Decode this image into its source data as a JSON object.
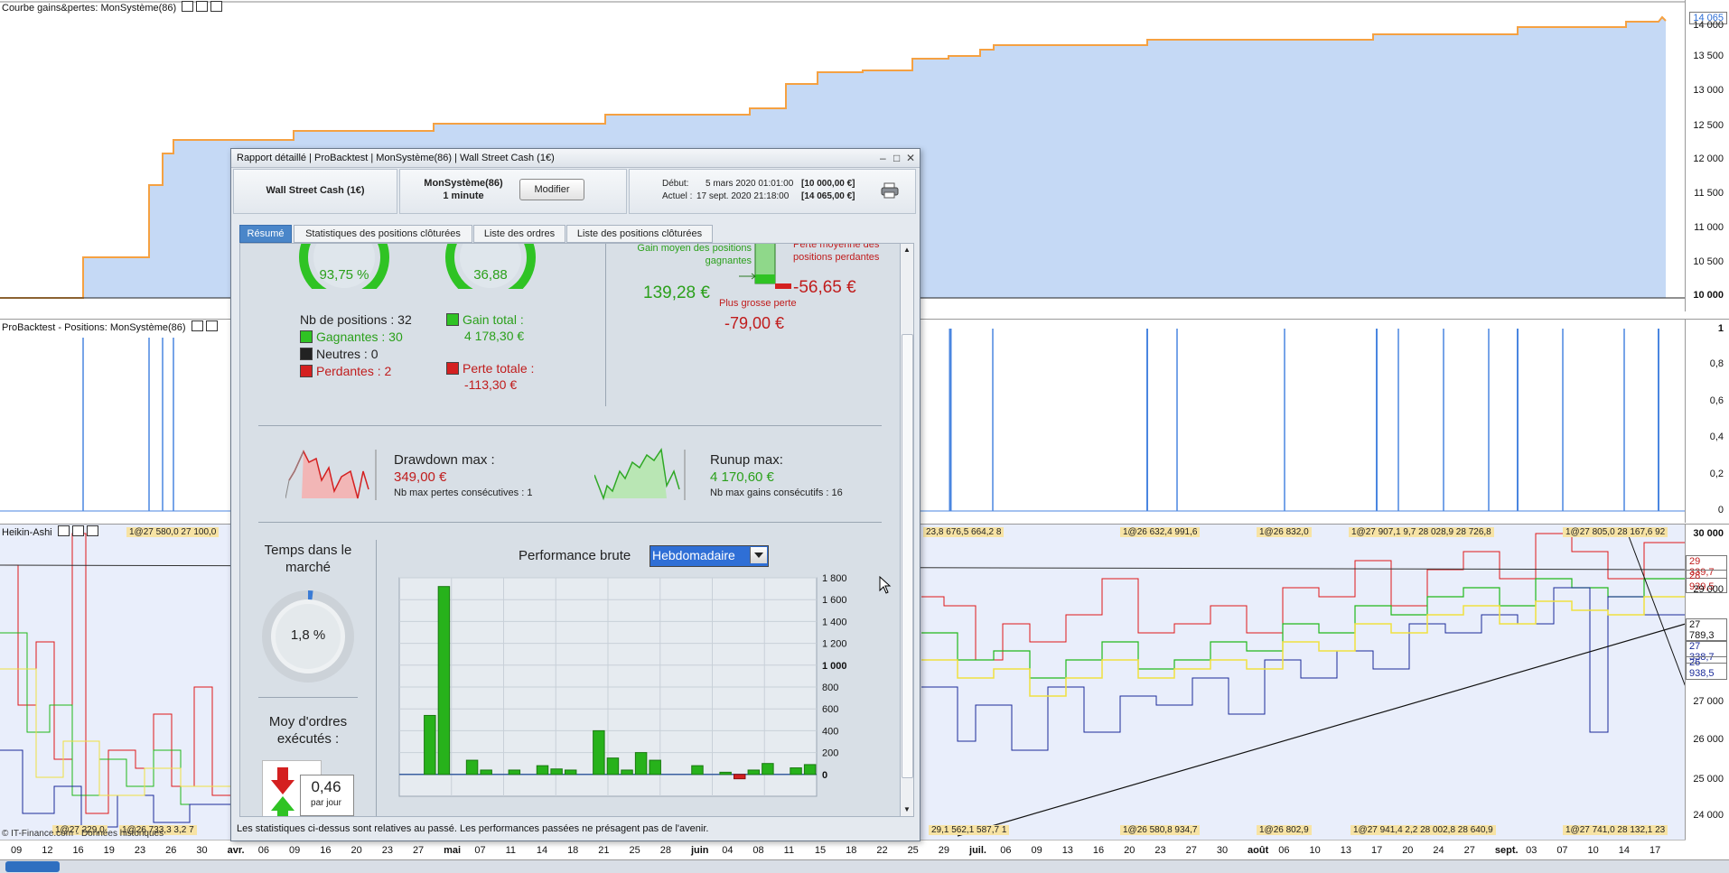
{
  "panels": {
    "equity": {
      "title": "Courbe gains&pertes: MonSystème(86)",
      "ticks": [
        "14 000",
        "13 500",
        "13 000",
        "12 500",
        "12 000",
        "11 500",
        "11 000",
        "10 500",
        "10 000"
      ],
      "last_value": "14 065"
    },
    "positions": {
      "title": "ProBacktest - Positions: MonSystème(86)",
      "ticks": [
        "1",
        "0,8",
        "0,6",
        "0,4",
        "0,2",
        "0"
      ]
    },
    "price": {
      "title": "Heikin-Ashi",
      "ticks": [
        "30 000",
        "29 000",
        "28 000",
        "27 000",
        "26 000",
        "25 000",
        "24 000"
      ],
      "levels": [
        "29 339,7",
        "28 939,5",
        "27 789,3",
        "27 338,7",
        "26 938,5"
      ],
      "tags_top": [
        "1@27 580,0 27 100,0",
        "23,8 676,5 664,2 8",
        "1@26 632,4 991,6",
        "1@26 832,0",
        "1@27 907,1 9,7 28 028,9 28 726,8",
        "1@27 805,0 28 167,6 92"
      ],
      "tags_bottom": [
        "1@27 229,0",
        "1@26 733,3 3,2 7",
        "29,1 562,1 587,7 1",
        "1@26 580,8 934,7",
        "1@26 802,9",
        "1@27 941,4 2,2 28 002,8 28 640,9",
        "1@27 741,0 28 132,1 23"
      ],
      "copyright": "© IT-Finance.com - Données historiques"
    }
  },
  "time_axis": [
    {
      "t": "09"
    },
    {
      "t": "12"
    },
    {
      "t": "16"
    },
    {
      "t": "19"
    },
    {
      "t": "23"
    },
    {
      "t": "26"
    },
    {
      "t": "30"
    },
    {
      "t": "avr.",
      "m": true
    },
    {
      "t": "06"
    },
    {
      "t": "09"
    },
    {
      "t": "16"
    },
    {
      "t": "20"
    },
    {
      "t": "23"
    },
    {
      "t": "27"
    },
    {
      "t": "mai",
      "m": true
    },
    {
      "t": "07"
    },
    {
      "t": "11"
    },
    {
      "t": "14"
    },
    {
      "t": "18"
    },
    {
      "t": "21"
    },
    {
      "t": "25"
    },
    {
      "t": "28"
    },
    {
      "t": "juin",
      "m": true
    },
    {
      "t": "04"
    },
    {
      "t": "08"
    },
    {
      "t": "11"
    },
    {
      "t": "15"
    },
    {
      "t": "18"
    },
    {
      "t": "22"
    },
    {
      "t": "25"
    },
    {
      "t": "29"
    },
    {
      "t": "juil.",
      "m": true
    },
    {
      "t": "06"
    },
    {
      "t": "09"
    },
    {
      "t": "13"
    },
    {
      "t": "16"
    },
    {
      "t": "20"
    },
    {
      "t": "23"
    },
    {
      "t": "27"
    },
    {
      "t": "30"
    },
    {
      "t": "août",
      "m": true
    },
    {
      "t": "06"
    },
    {
      "t": "10"
    },
    {
      "t": "13"
    },
    {
      "t": "17"
    },
    {
      "t": "20"
    },
    {
      "t": "24"
    },
    {
      "t": "27"
    },
    {
      "t": "sept.",
      "m": true
    },
    {
      "t": "03"
    },
    {
      "t": "07"
    },
    {
      "t": "10"
    },
    {
      "t": "14"
    },
    {
      "t": "17"
    }
  ],
  "report": {
    "title": "Rapport détaillé | ProBacktest | MonSystème(86) | Wall Street Cash (1€)",
    "instrument": "Wall Street Cash (1€)",
    "system": "MonSystème(86)",
    "timeframe": "1 minute",
    "modify": "Modifier",
    "start_label": "Début:",
    "start_value": "5 mars 2020 01:01:00",
    "start_capital": "[10 000,00 €]",
    "current_label": "Actuel :",
    "current_value": "17 sept. 2020 21:18:00",
    "current_capital": "[14 065,00 €]",
    "tabs": [
      "Résumé",
      "Statistiques des positions clôturées",
      "Liste des ordres",
      "Liste des positions clôturées"
    ],
    "win_rate": "93,75 %",
    "ratio": "36,88",
    "nb_positions": "Nb de positions : 32",
    "winners": "Gagnantes : 30",
    "neutral": "Neutres : 0",
    "losers": "Perdantes : 2",
    "gain_total_label": "Gain total :",
    "gain_total_value": "4 178,30 €",
    "loss_total_label": "Perte totale :",
    "loss_total_value": "-113,30 €",
    "avg_gain_label": "Gain moyen des positions gagnantes",
    "avg_gain_value": "139,28 €",
    "avg_loss_label": "Perte moyenne des positions perdantes",
    "avg_loss_value": "-56,65 €",
    "max_loss_label": "Plus grosse perte",
    "max_loss_value": "-79,00 €",
    "drawdown_label": "Drawdown max :",
    "drawdown_value": "349,00 €",
    "drawdown_sub": "Nb max pertes consécutives : 1",
    "runup_label": "Runup max:",
    "runup_value": "4 170,60 €",
    "runup_sub": "Nb max gains consécutifs : 16",
    "time_label": "Temps dans le marché",
    "time_value": "1,8 %",
    "orders_label": "Moy d'ordres exécutés :",
    "orders_value": "0,46",
    "orders_unit": "par jour",
    "perf_label": "Performance brute",
    "perf_select": "Hebdomadaire",
    "disclaimer": "Les statistiques ci-dessus sont relatives au passé. Les performances passées ne présagent pas de l'avenir."
  },
  "chart_data": {
    "type": "bar",
    "title": "Performance brute",
    "period": "Hebdomadaire",
    "ylim": [
      -200,
      1800
    ],
    "yticks": [
      0,
      200,
      400,
      600,
      800,
      1000,
      1200,
      1400,
      1600,
      1800
    ],
    "values": [
      0,
      540,
      1720,
      0,
      130,
      40,
      0,
      40,
      0,
      80,
      50,
      40,
      0,
      400,
      150,
      40,
      200,
      130,
      0,
      0,
      80,
      0,
      20,
      -40,
      40,
      100,
      0,
      60,
      90
    ]
  },
  "colors": {
    "equity_fill": "#c5d9f5",
    "equity_line": "#f5a142",
    "bar": "#27b21b",
    "bar_neg": "#d42020",
    "accent": "#4a86c9"
  }
}
